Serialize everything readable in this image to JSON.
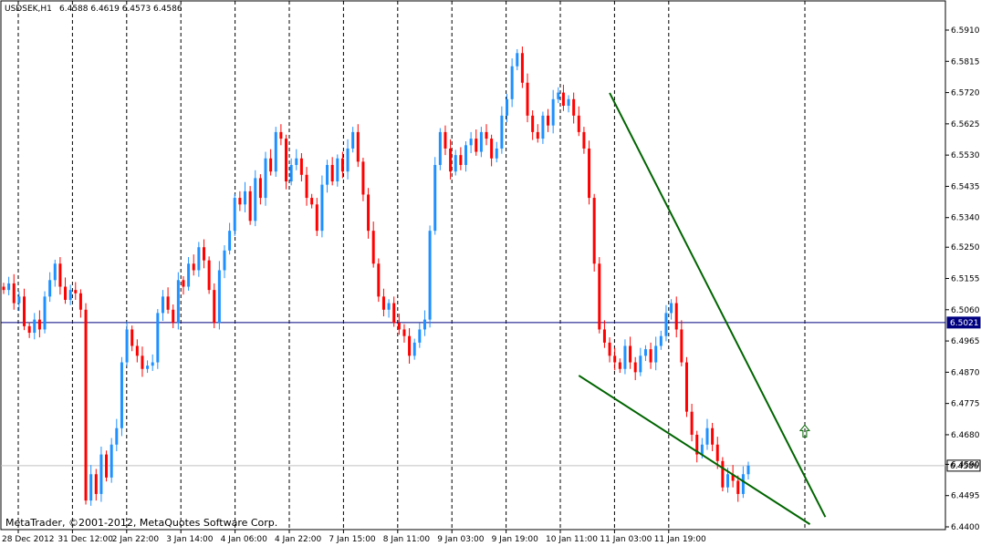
{
  "chart_data": {
    "type": "candlestick",
    "symbol": "USDSEK,H1",
    "ohlc_header": "6.4588 6.4619 6.4573 6.4586",
    "watermark": "MetaTrader, ©2001-2012, MetaQuotes Software Corp.",
    "ylim": [
      6.44,
      6.6005
    ],
    "y_ticks": [
      6.591,
      6.5815,
      6.572,
      6.5625,
      6.553,
      6.5435,
      6.534,
      6.525,
      6.5155,
      6.506,
      6.4965,
      6.487,
      6.4775,
      6.468,
      6.459,
      6.4495,
      6.44
    ],
    "y_tick_labels": [
      "6.5910",
      "6.5815",
      "6.5720",
      "6.5625",
      "6.5530",
      "6.5435",
      "6.5340",
      "6.5250",
      "6.5155",
      "6.5060",
      "6.4965",
      "6.4870",
      "6.4775",
      "6.4680",
      "6.4590",
      "6.4495",
      "6.4400"
    ],
    "x_labels": [
      "28 Dec 2012",
      "31 Dec 12:00",
      "2 Jan 22:00",
      "3 Jan 14:00",
      "4 Jan 06:00",
      "4 Jan 22:00",
      "7 Jan 15:00",
      "8 Jan 11:00",
      "9 Jan 03:00",
      "9 Jan 19:00",
      "10 Jan 11:00",
      "11 Jan 03:00",
      "11 Jan 19:00"
    ],
    "price_lines": [
      {
        "value": 6.5021,
        "label": "6.5021",
        "color": "#000080"
      },
      {
        "value": 6.4586,
        "label": "6.4586",
        "color": "#c0c0c0"
      }
    ],
    "closes": [
      6.512,
      6.514,
      6.508,
      6.51,
      6.501,
      6.499,
      6.503,
      6.5,
      6.51,
      6.515,
      6.52,
      6.513,
      6.509,
      6.512,
      6.511,
      6.506,
      6.448,
      6.456,
      6.45,
      6.462,
      6.455,
      6.465,
      6.47,
      6.49,
      6.5,
      6.495,
      6.492,
      6.488,
      6.489,
      6.49,
      6.505,
      6.51,
      6.506,
      6.502,
      6.515,
      6.513,
      6.52,
      6.518,
      6.525,
      6.521,
      6.512,
      6.502,
      6.518,
      6.524,
      6.53,
      6.54,
      6.538,
      6.542,
      6.533,
      6.546,
      6.54,
      6.552,
      6.548,
      6.56,
      6.558,
      6.545,
      6.55,
      6.552,
      6.547,
      6.54,
      6.538,
      6.53,
      6.544,
      6.55,
      6.545,
      6.552,
      6.548,
      6.555,
      6.56,
      6.551,
      6.541,
      6.53,
      6.52,
      6.51,
      6.506,
      6.508,
      6.502,
      6.5,
      6.498,
      6.492,
      6.496,
      6.5,
      6.503,
      6.53,
      6.55,
      6.56,
      6.555,
      6.548,
      6.553,
      6.55,
      6.556,
      6.558,
      6.554,
      6.56,
      6.558,
      6.552,
      6.555,
      6.565,
      6.57,
      6.58,
      6.584,
      6.575,
      6.565,
      6.56,
      6.558,
      6.565,
      6.562,
      6.57,
      6.572,
      6.568,
      6.57,
      6.565,
      6.56,
      6.555,
      6.54,
      6.52,
      6.5,
      6.496,
      6.492,
      6.49,
      6.488,
      6.495,
      6.49,
      6.487,
      6.492,
      6.494,
      6.49,
      6.495,
      6.498,
      6.505,
      6.508,
      6.5,
      6.49,
      6.475,
      6.468,
      6.462,
      6.465,
      6.47,
      6.465,
      6.46,
      6.452,
      6.456,
      6.454,
      6.45,
      6.456,
      6.4586
    ],
    "trendlines": [
      {
        "x1": 6.5719,
        "x2": 6.443,
        "from_bar": 118,
        "to_bar": 160,
        "color": "#006400"
      },
      {
        "x1": 6.486,
        "x2": 6.4408,
        "from_bar": 112,
        "to_bar": 157,
        "color": "#006400"
      }
    ],
    "arrow": {
      "bar": 156,
      "price": 6.469,
      "color": "#006400"
    }
  }
}
